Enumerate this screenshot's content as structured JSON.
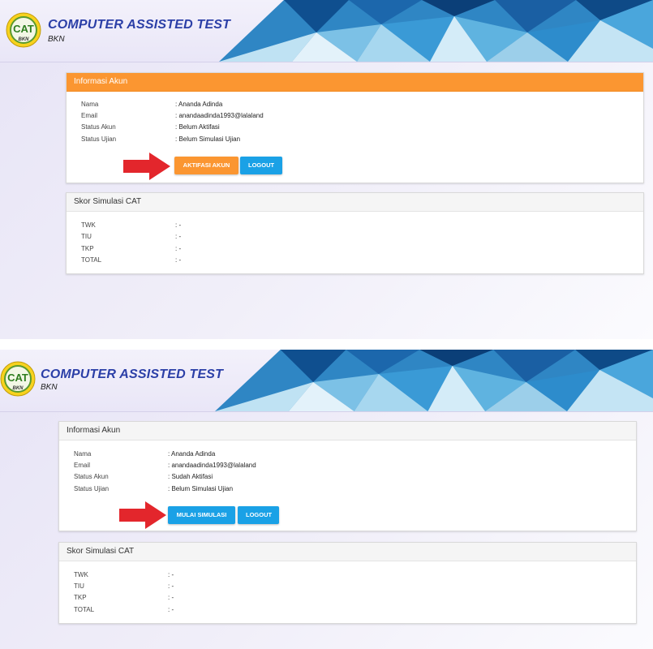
{
  "app": {
    "title": "COMPUTER ASSISTED TEST",
    "subtitle": "BKN",
    "logo_text": "CAT",
    "logo_sub": "BKN"
  },
  "colors": {
    "accent_orange": "#fb9631",
    "accent_blue": "#1aa1e6",
    "title_blue": "#2b3fa7",
    "arrow_red": "#e3262c"
  },
  "screens": [
    {
      "account_panel": {
        "title": "Informasi Akun",
        "rows": [
          {
            "label": "Nama",
            "value": ": Ananda Adinda"
          },
          {
            "label": "Email",
            "value": ": anandaadinda1993@lalaland"
          },
          {
            "label": "Status Akun",
            "value": ": Belum Aktifasi"
          },
          {
            "label": "Status Ujian",
            "value": ": Belum Simulasi Ujian"
          }
        ],
        "primary_button": "AKTIFASI AKUN",
        "logout_button": "LOGOUT"
      },
      "score_panel": {
        "title": "Skor Simulasi CAT",
        "rows": [
          {
            "label": "TWK",
            "value": ": -"
          },
          {
            "label": "TIU",
            "value": ": -"
          },
          {
            "label": "TKP",
            "value": ": -"
          },
          {
            "label": "TOTAL",
            "value": ": -"
          }
        ]
      }
    },
    {
      "account_panel": {
        "title": "Informasi Akun",
        "rows": [
          {
            "label": "Nama",
            "value": ": Ananda Adinda"
          },
          {
            "label": "Email",
            "value": ": anandaadinda1993@lalaland"
          },
          {
            "label": "Status Akun",
            "value": ": Sudah Aktifasi"
          },
          {
            "label": "Status Ujian",
            "value": ": Belum Simulasi Ujian"
          }
        ],
        "primary_button": "MULAI SIMULASI",
        "logout_button": "LOGOUT"
      },
      "score_panel": {
        "title": "Skor Simulasi CAT",
        "rows": [
          {
            "label": "TWK",
            "value": ": -"
          },
          {
            "label": "TIU",
            "value": ": -"
          },
          {
            "label": "TKP",
            "value": ": -"
          },
          {
            "label": "TOTAL",
            "value": ": -"
          }
        ]
      }
    }
  ]
}
